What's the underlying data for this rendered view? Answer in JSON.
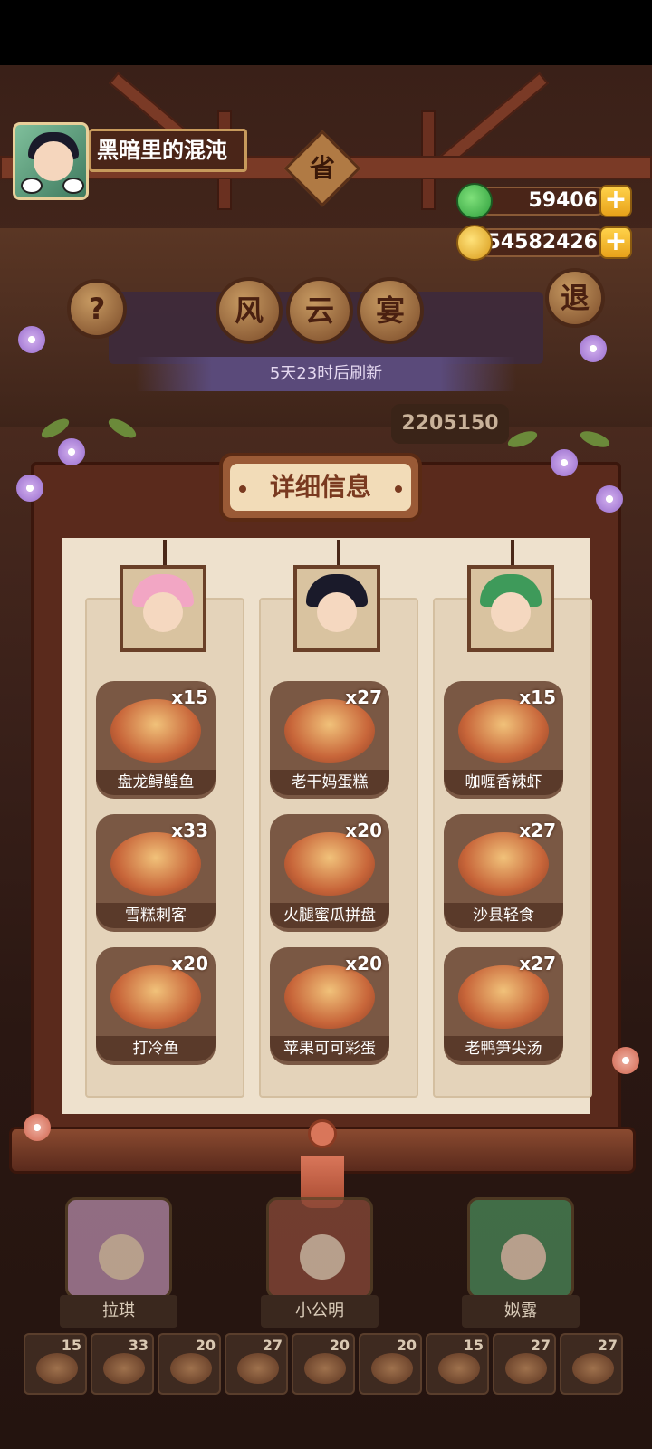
{
  "player": {
    "name": "黑暗里的混沌"
  },
  "currency": {
    "jade": "59406",
    "gold": "54582426"
  },
  "event": {
    "badge": "省",
    "title_chars": [
      "风",
      "云",
      "宴"
    ],
    "refresh": "5天23时后刷新",
    "score": "2205150"
  },
  "buttons": {
    "help": "?",
    "back": "退"
  },
  "panel": {
    "title": "详细信息"
  },
  "columns": [
    {
      "hair_color": "#f2a6c4",
      "dishes": [
        {
          "name": "盘龙鲟鳇鱼",
          "count": "x15"
        },
        {
          "name": "雪糕刺客",
          "count": "x33"
        },
        {
          "name": "打冷鱼",
          "count": "x20"
        }
      ]
    },
    {
      "hair_color": "#1a1a2a",
      "dishes": [
        {
          "name": "老干妈蛋糕",
          "count": "x27"
        },
        {
          "name": "火腿蜜瓜拼盘",
          "count": "x20"
        },
        {
          "name": "苹果可可彩蛋",
          "count": "x20"
        }
      ]
    },
    {
      "hair_color": "#3e9a5a",
      "dishes": [
        {
          "name": "咖喱香辣虾",
          "count": "x15"
        },
        {
          "name": "沙县轻食",
          "count": "x27"
        },
        {
          "name": "老鸭笋尖汤",
          "count": "x27"
        }
      ]
    }
  ],
  "characters": [
    {
      "name": "拉琪",
      "color": "#b58aa8"
    },
    {
      "name": "小公明",
      "color": "#8a4a3a"
    },
    {
      "name": "姒露",
      "color": "#4a8a5a"
    }
  ],
  "dish_strip": [
    "15",
    "33",
    "20",
    "27",
    "20",
    "20",
    "15",
    "27",
    "27"
  ]
}
